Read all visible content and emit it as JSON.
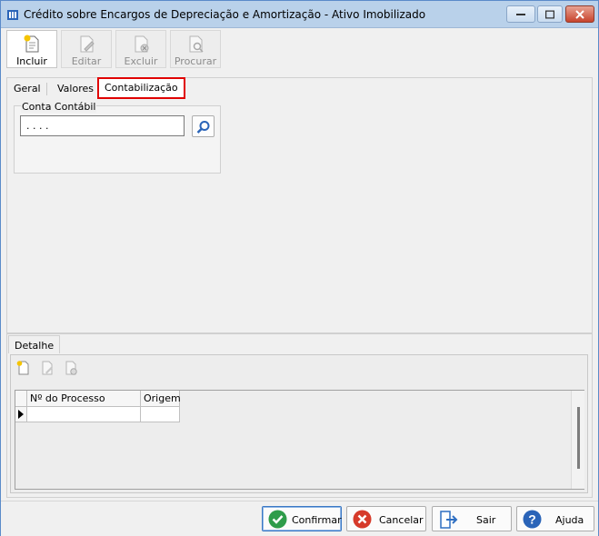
{
  "window": {
    "title": "Crédito sobre Encargos de Depreciação e Amortização - Ativo Imobilizado"
  },
  "toolbar": {
    "incluir": "Incluir",
    "editar": "Editar",
    "excluir": "Excluir",
    "procurar": "Procurar"
  },
  "tabs": [
    "Geral",
    "Valores",
    "Contabilização"
  ],
  "contabilizacao": {
    "group_label": "Conta Contábil",
    "conta_value": ". . . .",
    "search_icon": "magnifier-icon"
  },
  "detalhe": {
    "tab_label": "Detalhe",
    "columns": [
      "Nº do Processo",
      "Origem"
    ]
  },
  "footer": {
    "confirmar": "Confirmar",
    "cancelar": "Cancelar",
    "sair": "Sair",
    "ajuda": "Ajuda"
  },
  "colors": {
    "titlebar": "#b9d1ea",
    "tab_highlight": "#e00000",
    "confirm_green": "#2e9c4a",
    "cancel_red": "#d63a2a",
    "sair_blue": "#2f6fc2",
    "help_blue": "#2a64b8"
  }
}
